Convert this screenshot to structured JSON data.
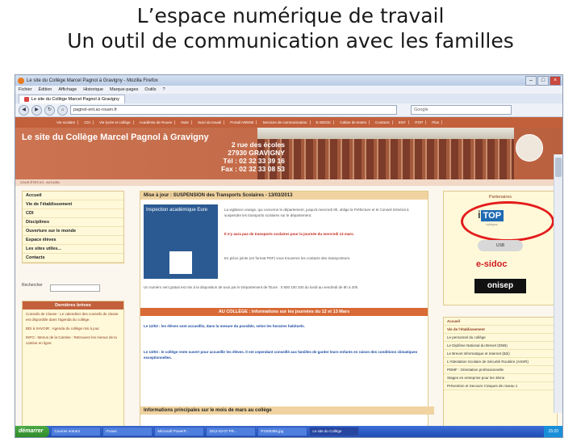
{
  "slide": {
    "title_line1": "L’espace numérique de travail",
    "title_line2": "Un outil de communication avec les familles"
  },
  "browser": {
    "window_title": "Le site du Collège Marcel Pagnol à Gravigny - Mozilla Firefox",
    "menu": [
      "Fichier",
      "Édition",
      "Affichage",
      "Historique",
      "Marque-pages",
      "Outils",
      "?"
    ],
    "tab_label": "Le site du Collège Marcel Pagnol à Gravigny",
    "url": "pagnol-ent.ac-rouen.fr",
    "search_placeholder": "Google"
  },
  "site": {
    "nav": [
      "Vie scolaire",
      "CDI",
      "Vie lycée et collège",
      "Académie de Rouen",
      "Note",
      "Suivi du travail",
      "Portail ARENE",
      "Services de communication",
      "E-SIDOC",
      "Cahier de textes",
      "Contacts",
      "ENT",
      "ITOP",
      "Plan"
    ],
    "title": "Le site du Collège Marcel Pagnol à Gravigny",
    "address": [
      "2 rue des écoles",
      "27930 GRAVIGNY",
      "Tél : 02 32 33 39 16",
      "Fax : 02 32 33 08 53"
    ],
    "date_bar": "VOUS ÊTES ICI : ACCUEIL",
    "left_menu": [
      "Accueil",
      "Vie de l'établissement",
      "CDI",
      "Disciplines",
      "Ouverture sur le monde",
      "Espace élèves",
      "Les sites utiles...",
      "Contacts"
    ],
    "search_label": "Rechercher",
    "breves_title": "Dernières brèves",
    "breves": [
      "Conseils de Classe : Le calendrier des conseils de classe est disponible dans l'agenda du collège.",
      "BDI à SAVOIR : Agenda du collège mis à jour.",
      "INFO : Menus de la Cantine : Retrouvez les menus de la cantine en ligne."
    ],
    "center": {
      "heading1": "Mise à jour : SUSPENSION des Transports Scolaires - 13/03/2013",
      "inspection_text": "Inspection académique Eure",
      "para1": "La vigilance orange, qui concerne le département, jusqu'à mercredi 9h, oblige la Préfecture et le Conseil Général à suspendre les transports scolaires sur le département.",
      "para2": "Il n'y aura pas de transports scolaires pour la journée du mercredi 13 mars.",
      "para3": "En pièce jointe (en format PDF) vous trouverez les contacts des transporteurs.",
      "para4": "Un numéro vert gratuit est mis à la disposition de tous par le Département de l'Eure : 0 800 100 200 du lundi au vendredi de 8h à 20h.",
      "heading2": "AU COLLÈGE : Informations sur les journées du 12 et 13 Mars",
      "para5": "Le 12/03 : les élèves sont accueillis, dans la mesure du possible, selon les horaires habituels.",
      "para6": "Le 13/03 : le collège reste ouvert pour accueillir les élèves. Il est cependant conseillé aux familles de garder leurs enfants en raison des conditions climatiques exceptionnelles.",
      "heading3": "Informations principales sur le mois de mars au collège"
    },
    "partners_title": "Partenaires",
    "itop": {
      "i": "i",
      "top": "TOP",
      "sub": "collèges"
    },
    "key_label": "USB",
    "esidoc": "e-sidoc",
    "onisep": "onisep",
    "accueil_menu": [
      {
        "label": "Accueil",
        "bold": true
      },
      {
        "label": "Vie de l'établissement",
        "bold": true
      },
      {
        "label": "Le personnel du collège",
        "bold": false
      },
      {
        "label": "Le Diplôme National du Brevet (DNB)",
        "bold": false
      },
      {
        "label": "Le Brevet Informatique et Internet (B2i)",
        "bold": false
      },
      {
        "label": "L'Attestation Scolaire de Sécurité Routière (ASSR)",
        "bold": false
      },
      {
        "label": "PDMF : Orientation professionnelle",
        "bold": false
      },
      {
        "label": "Stages en entreprise pour les 3ème",
        "bold": false
      },
      {
        "label": "Prévention et Secours Civiques de niveau 1",
        "bold": false
      }
    ]
  },
  "taskbar": {
    "start": "démarrer",
    "tasks": [
      "Courrier entrant",
      "iTunes",
      "Microsoft PowerP...",
      "2012-03-07 PR...",
      "P1000385.jpg",
      "Le site du Collège"
    ],
    "clock": "15:20"
  },
  "colors": {
    "accent": "#c2603c",
    "highlight_ring": "#e41c1c",
    "taskbar": "#1f4bb4"
  }
}
